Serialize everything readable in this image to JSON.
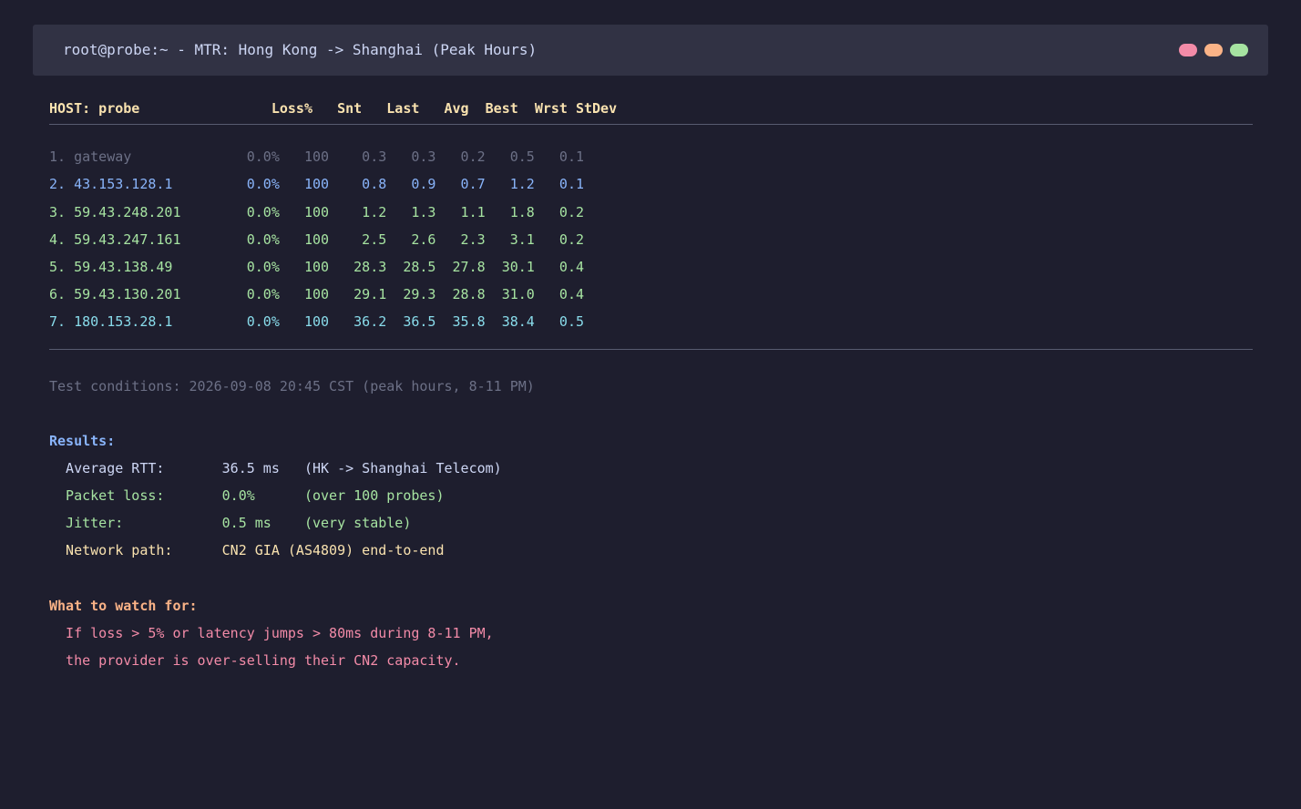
{
  "window": {
    "title": "root@probe:~ - MTR: Hong Kong -> Shanghai (Peak Hours)",
    "controls": [
      {
        "name": "close",
        "color": "#f38ba8"
      },
      {
        "name": "minimize",
        "color": "#fab387"
      },
      {
        "name": "maximize",
        "color": "#a6e3a1"
      }
    ]
  },
  "table": {
    "header": "HOST: probe                Loss%   Snt   Last   Avg  Best  Wrst StDev",
    "rows": [
      {
        "text": "1. gateway              0.0%   100    0.3   0.3   0.2   0.5   0.1",
        "color": "#6c7086"
      },
      {
        "text": "2. 43.153.128.1         0.0%   100    0.8   0.9   0.7   1.2   0.1",
        "color": "#89b4fa"
      },
      {
        "text": "3. 59.43.248.201        0.0%   100    1.2   1.3   1.1   1.8   0.2",
        "color": "#a6e3a1"
      },
      {
        "text": "4. 59.43.247.161        0.0%   100    2.5   2.6   2.3   3.1   0.2",
        "color": "#a6e3a1"
      },
      {
        "text": "5. 59.43.138.49         0.0%   100   28.3  28.5  27.8  30.1   0.4",
        "color": "#a6e3a1"
      },
      {
        "text": "6. 59.43.130.201        0.0%   100   29.1  29.3  28.8  31.0   0.4",
        "color": "#a6e3a1"
      },
      {
        "text": "7. 180.153.28.1         0.0%   100   36.2  36.5  35.8  38.4   0.5",
        "color": "#89dceb"
      }
    ]
  },
  "conditions": "Test conditions: 2026-09-08 20:45 CST (peak hours, 8-11 PM)",
  "results": {
    "heading": "Results:",
    "avg_rtt": "  Average RTT:       36.5 ms   (HK -> Shanghai Telecom)",
    "packet_loss": "  Packet loss:       0.0%      (over 100 probes)",
    "jitter": "  Jitter:            0.5 ms    (very stable)",
    "network_path": "  Network path:      CN2 GIA (AS4809) end-to-end"
  },
  "watch": {
    "heading": "What to watch for:",
    "line1": "  If loss > 5% or latency jumps > 80ms during 8-11 PM,",
    "line2": "  the provider is over-selling their CN2 capacity."
  }
}
